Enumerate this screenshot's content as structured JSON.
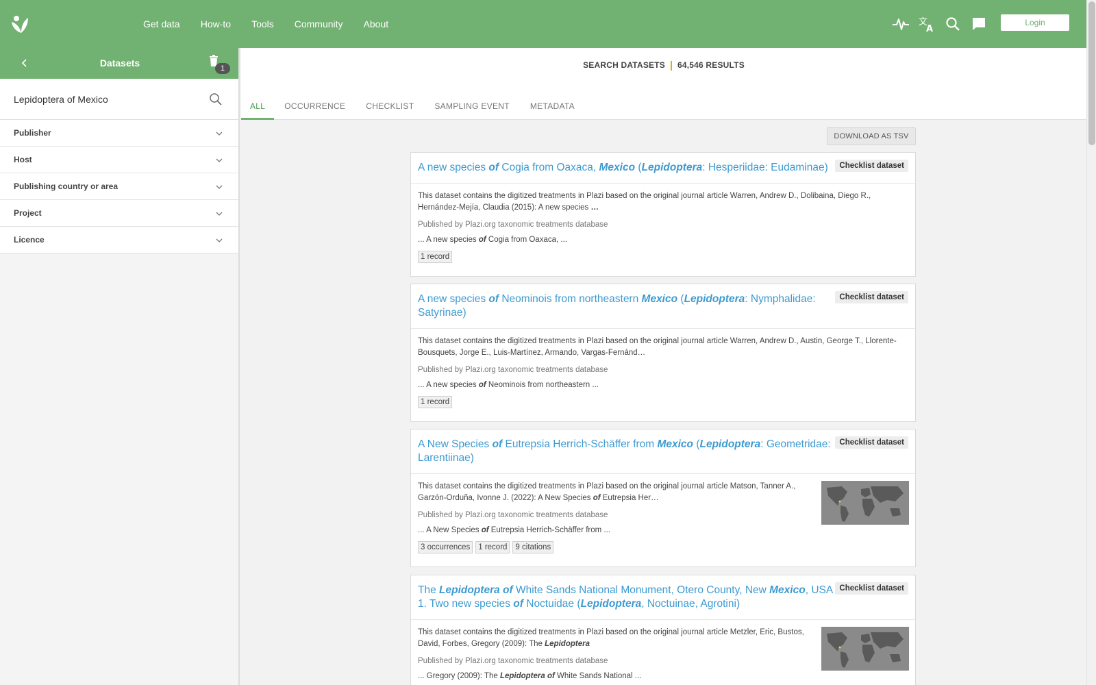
{
  "nav": {
    "items": [
      "Get data",
      "How-to",
      "Tools",
      "Community",
      "About"
    ],
    "login_label": "Login",
    "icons": [
      "activity-icon",
      "translate-icon",
      "search-icon",
      "feedback-icon"
    ]
  },
  "sidebar": {
    "title": "Datasets",
    "filter_count": "1",
    "search_value": "Lepidoptera of Mexico",
    "filters": [
      "Publisher",
      "Host",
      "Publishing country or area",
      "Project",
      "Licence"
    ]
  },
  "main": {
    "search_label": "SEARCH DATASETS",
    "results_label": "64,546 RESULTS",
    "tabs": [
      "ALL",
      "OCCURRENCE",
      "CHECKLIST",
      "SAMPLING EVENT",
      "METADATA"
    ],
    "active_tab": "ALL",
    "download_label": "DOWNLOAD AS TSV"
  },
  "results": [
    {
      "title_parts": [
        [
          "A new species ",
          ""
        ],
        [
          "of",
          "em"
        ],
        [
          " Cogia from Oaxaca, ",
          ""
        ],
        [
          "Mexico",
          "em"
        ],
        [
          " (",
          ""
        ],
        [
          "Lepidoptera",
          "em"
        ],
        [
          ": Hesperiidae: Eudaminae)",
          ""
        ]
      ],
      "type": "Checklist dataset",
      "desc_parts": [
        [
          "This dataset contains the digitized treatments in Plazi based on the original journal article Warren, Andrew D., Dolibaina, Diego R., Hernández-Mejía, Claudia (2015): A new species ",
          ""
        ],
        [
          "…",
          "b"
        ]
      ],
      "publisher": "Published by Plazi.org taxonomic treatments database",
      "snippet_parts": [
        [
          "... A new species ",
          ""
        ],
        [
          "of",
          "i"
        ],
        [
          " Cogia from Oaxaca, ...",
          ""
        ]
      ],
      "chips": [
        "1 record"
      ],
      "has_map": false
    },
    {
      "title_parts": [
        [
          "A new species ",
          ""
        ],
        [
          "of",
          "em"
        ],
        [
          " Neominois from northeastern ",
          ""
        ],
        [
          "Mexico",
          "em"
        ],
        [
          " (",
          ""
        ],
        [
          "Lepidoptera",
          "em"
        ],
        [
          ": Nymphalidae: Satyrinae)",
          ""
        ]
      ],
      "type": "Checklist dataset",
      "desc_parts": [
        [
          "This dataset contains the digitized treatments in Plazi based on the original journal article Warren, Andrew D., Austin, George T., Llorente-Bousquets, Jorge E., Luis-Martínez, Armando, Vargas-Fernánd…",
          ""
        ]
      ],
      "publisher": "Published by Plazi.org taxonomic treatments database",
      "snippet_parts": [
        [
          "... A new species ",
          ""
        ],
        [
          "of",
          "i"
        ],
        [
          " Neominois from northeastern ...",
          ""
        ]
      ],
      "chips": [
        "1 record"
      ],
      "has_map": false
    },
    {
      "title_parts": [
        [
          "A New Species ",
          ""
        ],
        [
          "of",
          "em"
        ],
        [
          " Eutrepsia Herrich-Schäffer from ",
          ""
        ],
        [
          "Mexico",
          "em"
        ],
        [
          " (",
          ""
        ],
        [
          "Lepidoptera",
          "em"
        ],
        [
          ": Geometridae: Larentiinae)",
          ""
        ]
      ],
      "type": "Checklist dataset",
      "desc_parts": [
        [
          "This dataset contains the digitized treatments in Plazi based on the original journal article Matson, Tanner A., Garzón-Orduña, Ivonne J. (2022): A New Species ",
          ""
        ],
        [
          "of",
          "i"
        ],
        [
          " Eutrepsia Her…",
          ""
        ]
      ],
      "publisher": "Published by Plazi.org taxonomic treatments database",
      "snippet_parts": [
        [
          "... A New Species ",
          ""
        ],
        [
          "of",
          "i"
        ],
        [
          " Eutrepsia Herrich-Schäffer from ...",
          ""
        ]
      ],
      "chips": [
        "3 occurrences",
        "1 record",
        "9 citations"
      ],
      "has_map": true
    },
    {
      "title_parts": [
        [
          "The ",
          ""
        ],
        [
          "Lepidoptera",
          "em"
        ],
        [
          " ",
          ""
        ],
        [
          "of",
          "em"
        ],
        [
          " White Sands National Monument, Otero County, New ",
          ""
        ],
        [
          "Mexico",
          "em"
        ],
        [
          ", USA 1. Two new species ",
          ""
        ],
        [
          "of",
          "em"
        ],
        [
          " Noctuidae (",
          ""
        ],
        [
          "Lepidoptera",
          "em"
        ],
        [
          ", Noctuinae, Agrotini)",
          ""
        ]
      ],
      "type": "Checklist dataset",
      "desc_parts": [
        [
          "This dataset contains the digitized treatments in Plazi based on the original journal article Metzler, Eric, Bustos, David, Forbes, Gregory (2009): The ",
          ""
        ],
        [
          "Lepidoptera",
          "i"
        ]
      ],
      "publisher": "Published by Plazi.org taxonomic treatments database",
      "snippet_parts": [
        [
          "... Gregory (2009): The ",
          ""
        ],
        [
          "Lepidoptera",
          "i"
        ],
        [
          " ",
          ""
        ],
        [
          "of",
          "i"
        ],
        [
          " White Sands National ...",
          ""
        ]
      ],
      "chips": [],
      "has_map": true
    }
  ],
  "colors": {
    "brand_green": "#71b171",
    "link_blue": "#3d9ad1",
    "results_separator": "#e0b000"
  }
}
